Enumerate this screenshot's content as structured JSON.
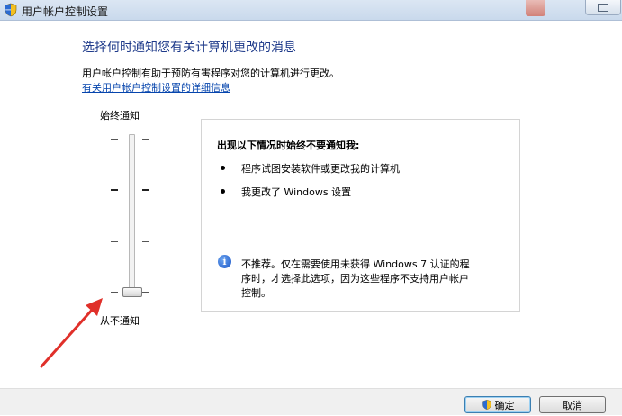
{
  "window": {
    "title": "用户帐户控制设置"
  },
  "main": {
    "heading": "选择何时通知您有关计算机更改的消息",
    "description": "用户帐户控制有助于预防有害程序对您的计算机进行更改。",
    "help_link": "有关用户帐户控制设置的详细信息"
  },
  "slider": {
    "top_label": "始终通知",
    "bottom_label": "从不通知",
    "levels": 4,
    "selected_level": 1
  },
  "info": {
    "title": "出现以下情况时始终不要通知我:",
    "bullets": [
      "程序试图安装软件或更改我的计算机",
      "我更改了 Windows 设置"
    ],
    "note_lines": [
      "不推荐。仅在需要使用未获得 Windows 7 认证的程",
      "序时，才选择此选项，因为这些程序不支持用户帐户",
      "控制。"
    ]
  },
  "buttons": {
    "ok": "确定",
    "cancel": "取消"
  },
  "colors": {
    "heading": "#1e3a8a",
    "link": "#0645ad",
    "arrow": "#e0302a"
  }
}
